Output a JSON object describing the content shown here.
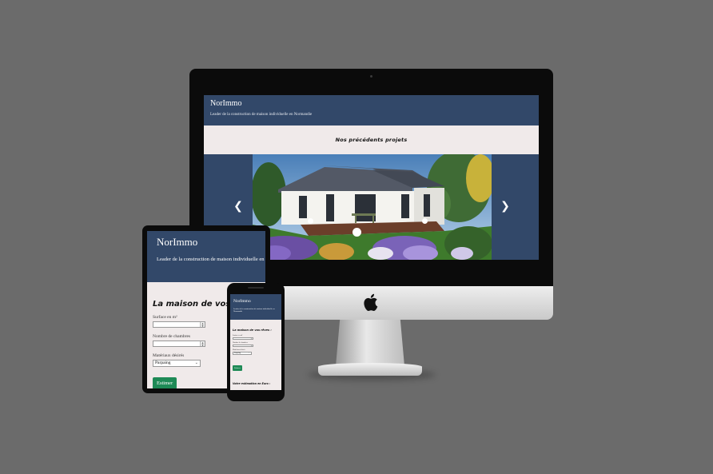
{
  "site": {
    "brand": "NorImmo",
    "tagline": "Leader de la construction de maison individuelle en Normandie"
  },
  "desktop": {
    "section_title": "Nos précédents projets",
    "carousel": {
      "prev_icon": "chevron-left-icon",
      "next_icon": "chevron-right-icon",
      "prev_glyph": "❮",
      "next_glyph": "❯",
      "slide_alt": "Maison plain-pied moderne avec terrasse et jardin fleuri"
    }
  },
  "form": {
    "title": "La maison de vos rêves :",
    "fields": [
      {
        "label": "Surface en m²",
        "type": "number",
        "value": ""
      },
      {
        "label": "Nombre de chambres",
        "type": "number",
        "value": ""
      },
      {
        "label": "Matériaux désirés",
        "type": "select",
        "value": "Parpaing"
      }
    ],
    "submit_label": "Estimer",
    "result_title": "Votre estimation en Euro :"
  },
  "colors": {
    "background": "#6b6b6b",
    "header": "#324869",
    "page": "#f0eaea",
    "button": "#1e8a56"
  }
}
